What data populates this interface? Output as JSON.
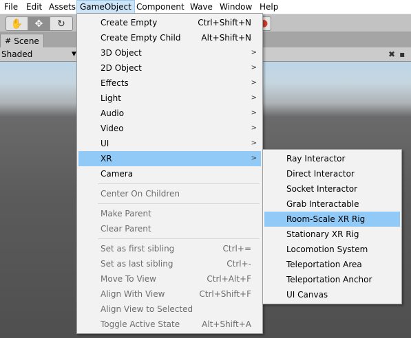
{
  "menubar": {
    "items": [
      "File",
      "Edit",
      "Assets",
      "GameObject",
      "Component",
      "Wave",
      "Window",
      "Help"
    ],
    "active": "GameObject"
  },
  "toolbar": {
    "tools": [
      {
        "icon": "hand-icon",
        "glyph": "✋"
      },
      {
        "icon": "move-icon",
        "glyph": "✥"
      },
      {
        "icon": "rotate-icon",
        "glyph": "↻"
      }
    ]
  },
  "scene_tab": {
    "label": "Scene",
    "icon": "scene-grid-icon"
  },
  "scene_toolbar": {
    "shading_mode": "Shaded",
    "tools_icon": "crossed-tools-icon"
  },
  "gameobject_menu": {
    "items": [
      {
        "label": "Create Empty",
        "shortcut": "Ctrl+Shift+N",
        "enabled": true
      },
      {
        "label": "Create Empty Child",
        "shortcut": "Alt+Shift+N",
        "enabled": true
      },
      {
        "label": "3D Object",
        "submenu": true,
        "enabled": true
      },
      {
        "label": "2D Object",
        "submenu": true,
        "enabled": true
      },
      {
        "label": "Effects",
        "submenu": true,
        "enabled": true
      },
      {
        "label": "Light",
        "submenu": true,
        "enabled": true
      },
      {
        "label": "Audio",
        "submenu": true,
        "enabled": true
      },
      {
        "label": "Video",
        "submenu": true,
        "enabled": true
      },
      {
        "label": "UI",
        "submenu": true,
        "enabled": true
      },
      {
        "label": "XR",
        "submenu": true,
        "enabled": true,
        "highlighted": true
      },
      {
        "label": "Camera",
        "enabled": true
      },
      {
        "label": "Center On Children",
        "enabled": false
      },
      {
        "label": "Make Parent",
        "enabled": false
      },
      {
        "label": "Clear Parent",
        "enabled": false
      },
      {
        "label": "Set as first sibling",
        "shortcut": "Ctrl+=",
        "enabled": false
      },
      {
        "label": "Set as last sibling",
        "shortcut": "Ctrl+-",
        "enabled": false
      },
      {
        "label": "Move To View",
        "shortcut": "Ctrl+Alt+F",
        "enabled": false
      },
      {
        "label": "Align With View",
        "shortcut": "Ctrl+Shift+F",
        "enabled": false
      },
      {
        "label": "Align View to Selected",
        "enabled": false
      },
      {
        "label": "Toggle Active State",
        "shortcut": "Alt+Shift+A",
        "enabled": false
      }
    ]
  },
  "xr_submenu": {
    "items": [
      {
        "label": "Ray Interactor"
      },
      {
        "label": "Direct Interactor"
      },
      {
        "label": "Socket Interactor"
      },
      {
        "label": "Grab Interactable"
      },
      {
        "label": "Room-Scale XR Rig",
        "highlighted": true
      },
      {
        "label": "Stationary XR Rig"
      },
      {
        "label": "Locomotion System"
      },
      {
        "label": "Teleportation Area"
      },
      {
        "label": "Teleportation Anchor"
      },
      {
        "label": "UI Canvas"
      }
    ]
  },
  "colors": {
    "highlight": "#91c9f7",
    "menubar_active": "#cce4f7",
    "disabled_text": "#6d6d6d"
  }
}
